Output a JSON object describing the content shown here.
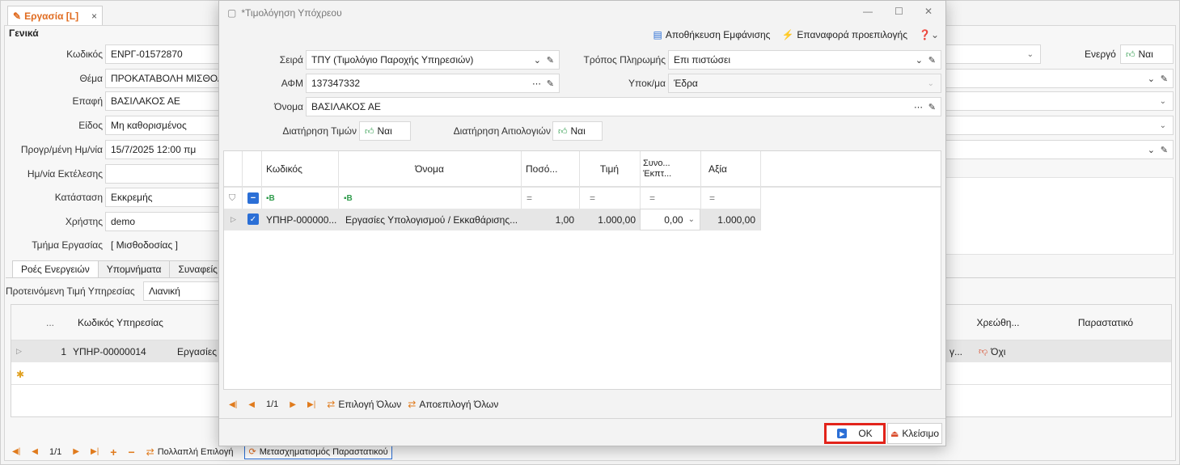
{
  "bg": {
    "tab_title": "Εργασία [L]",
    "tab_close": "×",
    "section_title": "Γενικά",
    "fields": [
      {
        "label": "Κωδικός",
        "value": "ΕΝΡΓ-01572870"
      },
      {
        "label": "Θέμα",
        "value": "ΠΡΟΚΑΤΑΒΟΛΗ ΜΙΣΘΟΔΟΣ"
      },
      {
        "label": "Επαφή",
        "value": "ΒΑΣΙΛΑΚΟΣ ΑΕ"
      },
      {
        "label": "Είδος",
        "value": "Μη καθορισμένος"
      },
      {
        "label": "Προγρ/μένη Ημ/νία",
        "value": "15/7/2025 12:00 πμ"
      },
      {
        "label": "Ημ/νία Εκτέλεσης",
        "value": ""
      },
      {
        "label": "Κατάσταση",
        "value": "Εκκρεμής"
      },
      {
        "label": "Χρήστης",
        "value": "demo"
      },
      {
        "label": "Τμήμα Εργασίας",
        "value": "[ Μισθοδοσίας ]"
      }
    ],
    "active_label": "Ενεργό",
    "active_value": "Ναι",
    "subtabs": [
      "Ροές Ενεργειών",
      "Υπομνήματα",
      "Συναφείς Ε"
    ],
    "price_label": "Προτεινόμενη Τιμή Υπηρεσίας",
    "price_value": "Λιανική",
    "grid": {
      "headers": [
        "...",
        "Κωδικός Υπηρεσίας",
        "Χρεώθη...",
        "Παραστατικό"
      ],
      "row": {
        "num": "1",
        "code": "ΥΠΗΡ-00000014",
        "name": "Εργασίες Υ",
        "partial": "γ...",
        "charged": "Όχι"
      }
    },
    "nav": {
      "pages": "1/1",
      "multi_select": "Πολλαπλή Επιλογή",
      "transform": "Μετασχηματισμός Παραστατικού"
    }
  },
  "dialog": {
    "title": "*Τιμολόγηση Υπόχρεου",
    "save_view": "Αποθήκευση Εμφάνισης",
    "reset_default": "Επαναφορά προεπιλογής",
    "series_label": "Σειρά",
    "series_value": "ΤΠΥ (Τιμολόγιο Παροχής Υπηρεσιών)",
    "payment_label": "Τρόπος Πληρωμής",
    "payment_value": "Επι πιστώσει",
    "afm_label": "ΑΦΜ",
    "afm_value": "137347332",
    "branch_label": "Υποκ/μα",
    "branch_value": "Έδρα",
    "name_label": "Όνομα",
    "name_value": "ΒΑΣΙΛΑΚΟΣ ΑΕ",
    "keep_prices_label": "Διατήρηση Τιμών",
    "keep_prices_value": "Ναι",
    "keep_reasons_label": "Διατήρηση Αιτιολογιών",
    "keep_reasons_value": "Ναι",
    "grid": {
      "headers": [
        "Κωδικός",
        "Όνομα",
        "Ποσό...",
        "Τιμή",
        "Συνο... Έκπτ...",
        "Αξία"
      ],
      "filter_eq": "=",
      "row": {
        "code": "ΥΠΗΡ-000000...",
        "name": "Εργασίες Υπολογισμού / Εκκαθάρισης...",
        "qty": "1,00",
        "price": "1.000,00",
        "discount": "0,00",
        "value": "1.000,00"
      }
    },
    "nav": {
      "pages": "1/1",
      "select_all": "Επιλογή Όλων",
      "deselect_all": "Αποεπιλογή Όλων"
    },
    "ok_label": "OK",
    "close_label": "Κλείσιμο"
  },
  "colors": {
    "accent_orange": "#e06b1f",
    "highlight_red": "#e2231a",
    "selection_blue": "#2b6fd6",
    "row_selected": "#e6e6e6"
  }
}
